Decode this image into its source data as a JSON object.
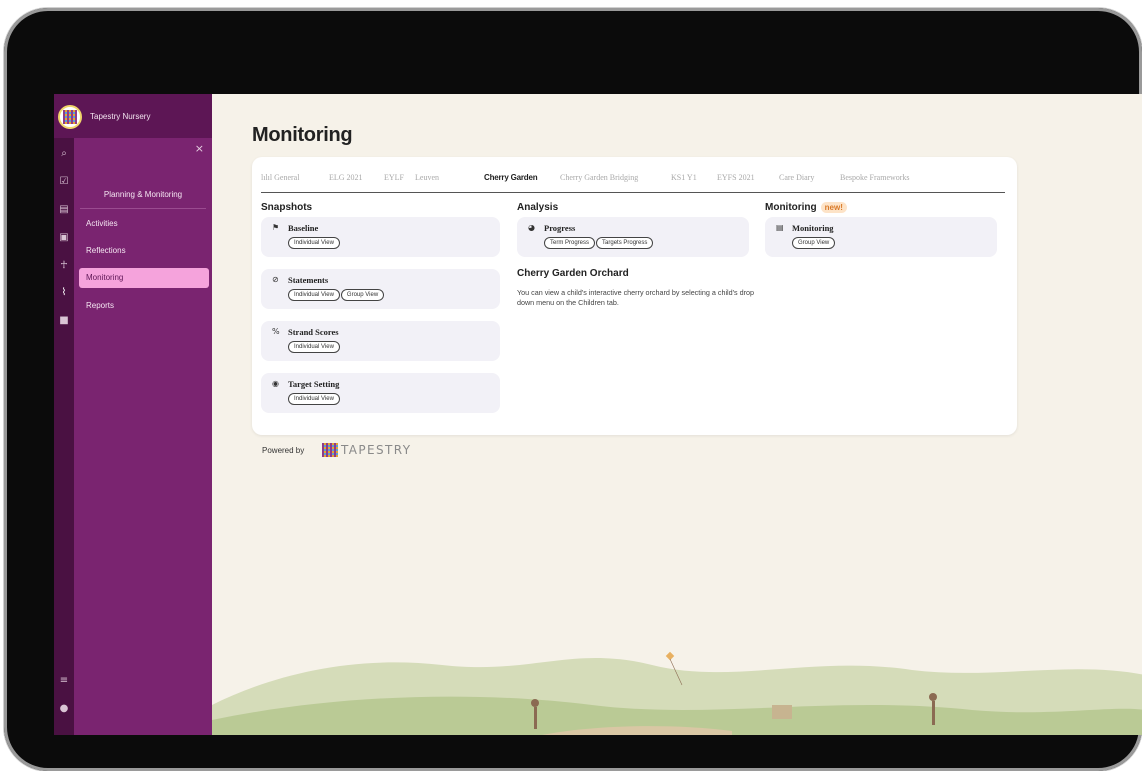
{
  "app": {
    "org_name": "Tapestry Nursery"
  },
  "rail_icons": [
    "search-icon",
    "calendar-check-icon",
    "id-card-icon",
    "journal-icon",
    "child-icon",
    "chart-icon",
    "folder-icon",
    "settings-sliders-icon",
    "help-icon"
  ],
  "panel": {
    "close_glyph": "×",
    "title": "Planning & Monitoring",
    "items": [
      {
        "label": "Activities"
      },
      {
        "label": "Reflections"
      },
      {
        "label": "Monitoring",
        "active": true
      },
      {
        "label": "Reports"
      }
    ]
  },
  "page": {
    "title": "Monitoring"
  },
  "tabs": [
    {
      "label": "lılıl General"
    },
    {
      "label": "ELG 2021"
    },
    {
      "label": "EYLF"
    },
    {
      "label": "Leuven"
    },
    {
      "label": "Cherry Garden",
      "active": true
    },
    {
      "label": "Cherry Garden Bridging"
    },
    {
      "label": "KS1 Y1"
    },
    {
      "label": "EYFS 2021"
    },
    {
      "label": "Care Diary"
    },
    {
      "label": "Bespoke Frameworks"
    }
  ],
  "columns": {
    "snapshots": "Snapshots",
    "analysis": "Analysis",
    "monitoring": "Monitoring",
    "monitoring_badge": "new!"
  },
  "tiles": {
    "baseline": {
      "label": "Baseline",
      "icon": "flag-icon",
      "pills": [
        "Individual View"
      ]
    },
    "statements": {
      "label": "Statements",
      "icon": "check-circle-icon",
      "pills": [
        "Individual View",
        "Group View"
      ]
    },
    "strand_scores": {
      "label": "Strand Scores",
      "icon": "percent-icon",
      "pills": [
        "Individual View"
      ]
    },
    "target_setting": {
      "label": "Target Setting",
      "icon": "target-icon",
      "pills": [
        "Individual View"
      ]
    },
    "progress": {
      "label": "Progress",
      "icon": "pie-chart-icon",
      "pills": [
        "Term Progress",
        "Targets Progress"
      ]
    },
    "monitoring": {
      "label": "Monitoring",
      "icon": "list-icon",
      "pills": [
        "Group View"
      ]
    }
  },
  "orchard": {
    "title": "Cherry Garden Orchard",
    "text": "You can view a child's interactive cherry orchard by selecting a child's drop down menu on the Children tab."
  },
  "footer": {
    "powered_by": "Powered by",
    "brand": "TAPESTRY"
  },
  "colors": {
    "rail": "#4a1142",
    "panel": "#7a2470",
    "active_item": "#f5a3dc",
    "badge_bg": "#fde3c7",
    "badge_text": "#d97a29"
  }
}
